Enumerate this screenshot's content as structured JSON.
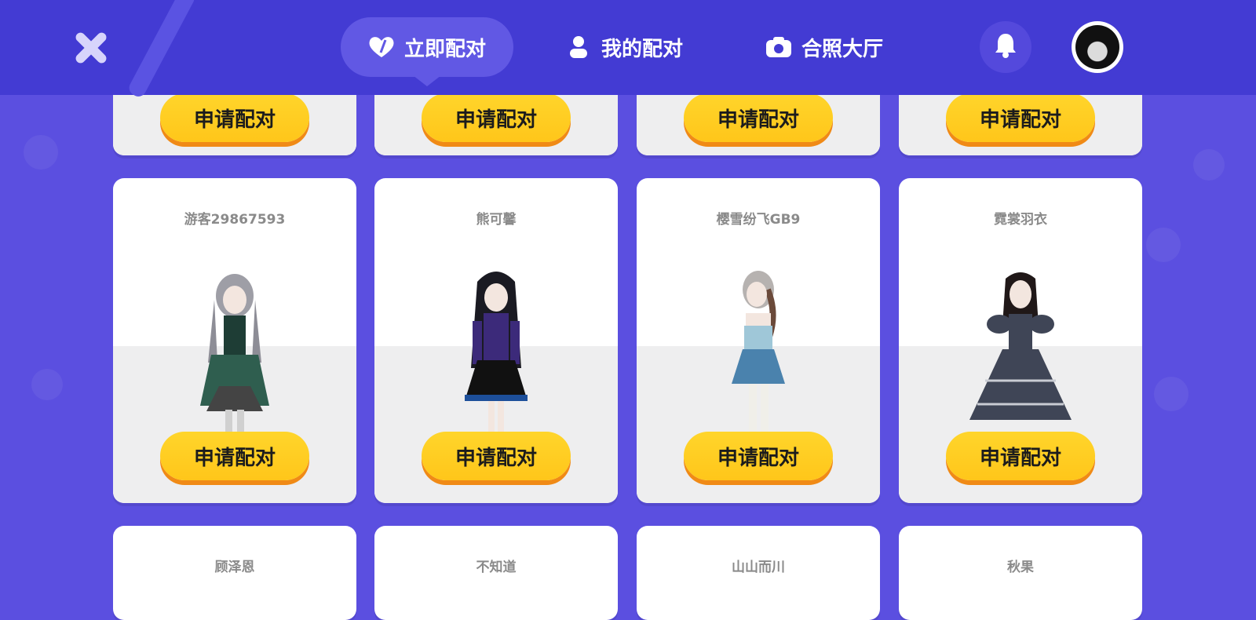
{
  "nav": {
    "tabs": [
      {
        "label": "立即配对",
        "icon": "heart-icon",
        "active": true
      },
      {
        "label": "我的配对",
        "icon": "person-icon",
        "active": false
      },
      {
        "label": "合照大厅",
        "icon": "camera-icon",
        "active": false
      }
    ]
  },
  "colors": {
    "background": "#5b4fe0",
    "topbar": "#433bd3",
    "button": "#ffc61a",
    "button_shadow": "#f08a16"
  },
  "apply_label": "申请配对",
  "cards_row2": [
    {
      "name": "游客29867593",
      "palette": {
        "hair": "#9e9ea6",
        "dress": "#2f5e4f"
      }
    },
    {
      "name": "熊可馨",
      "palette": {
        "hair": "#1a1a22",
        "dress": "#3c2a7a"
      }
    },
    {
      "name": "樱雪纷飞GB9",
      "palette": {
        "hair": "#b6b2b0",
        "dress": "#4a82ad"
      }
    },
    {
      "name": "霓裳羽衣",
      "palette": {
        "hair": "#201818",
        "dress": "#3f4556"
      }
    }
  ],
  "cards_row3": [
    {
      "name": "顾泽恩"
    },
    {
      "name": "不知道"
    },
    {
      "name": "山山而川"
    },
    {
      "name": "秋果"
    }
  ]
}
